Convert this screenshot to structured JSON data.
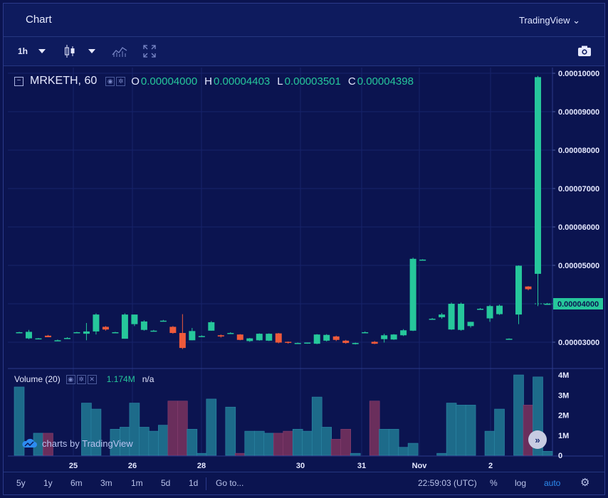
{
  "header": {
    "title": "Chart",
    "provider": "TradingView ⌄"
  },
  "toolbar": {
    "interval": "1h",
    "icons": [
      "candles-icon",
      "dropdown-icon",
      "indicators-icon",
      "fullscreen-icon",
      "camera-icon"
    ]
  },
  "legend": {
    "symbol": "MRKETH, 60",
    "o_label": "O",
    "o": "0.00004000",
    "h_label": "H",
    "h": "0.00004403",
    "l_label": "L",
    "l": "0.00003501",
    "c_label": "C",
    "c": "0.00004398"
  },
  "volume_legend": {
    "title": "Volume (20)",
    "value": "1.174M",
    "na": "n/a"
  },
  "brand": "charts by TradingView",
  "bottombar": {
    "ranges": [
      "5y",
      "1y",
      "6m",
      "3m",
      "1m",
      "5d",
      "1d"
    ],
    "goto": "Go to...",
    "time": "22:59:03 (UTC)",
    "percent": "%",
    "log": "log",
    "auto": "auto"
  },
  "colors": {
    "bg": "#0b1450",
    "up": "#26c79b",
    "down": "#ef5a3b",
    "accent": "#2d8cf0"
  },
  "chart_data": {
    "type": "candlestick",
    "price_axis_labels": [
      "0.00010000",
      "0.00009000",
      "0.00008000",
      "0.00007000",
      "0.00006000",
      "0.00005000",
      "0.00003000"
    ],
    "last_price_label": "0.00004000",
    "volume_axis_labels": [
      "4M",
      "3M",
      "2M",
      "1M",
      "0"
    ],
    "x_tick_labels": [
      "25",
      "26",
      "28",
      "30",
      "31",
      "Nov",
      "2"
    ],
    "ylim": [
      2.7e-05,
      0.000101
    ],
    "volume_ylim": [
      0,
      4000000
    ],
    "candles": [
      {
        "o": 3.25e-05,
        "h": 3.27e-05,
        "l": 3.25e-05,
        "c": 3.26e-05
      },
      {
        "o": 3.1e-05,
        "h": 3.32e-05,
        "l": 3.08e-05,
        "c": 3.27e-05
      },
      {
        "o": 3.09e-05,
        "h": 3.11e-05,
        "l": 3.08e-05,
        "c": 3.1e-05
      },
      {
        "o": 3.17e-05,
        "h": 3.19e-05,
        "l": 3.13e-05,
        "c": 3.13e-05
      },
      {
        "o": 3.05e-05,
        "h": 3.07e-05,
        "l": 3.03e-05,
        "c": 3.05e-05
      },
      {
        "o": 3.11e-05,
        "h": 3.13e-05,
        "l": 3.09e-05,
        "c": 3.11e-05
      },
      {
        "o": 3.25e-05,
        "h": 3.27e-05,
        "l": 3.24e-05,
        "c": 3.26e-05
      },
      {
        "o": 3.22e-05,
        "h": 3.5e-05,
        "l": 3.05e-05,
        "c": 3.28e-05
      },
      {
        "o": 3.28e-05,
        "h": 3.75e-05,
        "l": 3.2e-05,
        "c": 3.72e-05
      },
      {
        "o": 3.4e-05,
        "h": 3.42e-05,
        "l": 3.3e-05,
        "c": 3.33e-05
      },
      {
        "o": 3.25e-05,
        "h": 3.27e-05,
        "l": 3.24e-05,
        "c": 3.26e-05
      },
      {
        "o": 3.09e-05,
        "h": 3.75e-05,
        "l": 3.09e-05,
        "c": 3.72e-05
      },
      {
        "o": 3.47e-05,
        "h": 3.72e-05,
        "l": 3.42e-05,
        "c": 3.72e-05
      },
      {
        "o": 3.32e-05,
        "h": 3.57e-05,
        "l": 3.3e-05,
        "c": 3.54e-05
      },
      {
        "o": 3.3e-05,
        "h": 3.32e-05,
        "l": 3.29e-05,
        "c": 3.3e-05
      },
      {
        "o": 3.56e-05,
        "h": 3.58e-05,
        "l": 3.54e-05,
        "c": 3.56e-05
      },
      {
        "o": 3.4e-05,
        "h": 3.42e-05,
        "l": 3.22e-05,
        "c": 3.24e-05
      },
      {
        "o": 3.24e-05,
        "h": 3.73e-05,
        "l": 2.82e-05,
        "c": 2.85e-05
      },
      {
        "o": 3.05e-05,
        "h": 3.37e-05,
        "l": 3.05e-05,
        "c": 3.29e-05
      },
      {
        "o": 3.16e-05,
        "h": 3.18e-05,
        "l": 3.14e-05,
        "c": 3.16e-05
      },
      {
        "o": 3.3e-05,
        "h": 3.55e-05,
        "l": 3.3e-05,
        "c": 3.52e-05
      },
      {
        "o": 3.18e-05,
        "h": 3.2e-05,
        "l": 3.12e-05,
        "c": 3.15e-05
      },
      {
        "o": 3.24e-05,
        "h": 3.26e-05,
        "l": 3.22e-05,
        "c": 3.24e-05
      },
      {
        "o": 3.2e-05,
        "h": 3.21e-05,
        "l": 3.05e-05,
        "c": 3.06e-05
      },
      {
        "o": 3.03e-05,
        "h": 3.11e-05,
        "l": 3.01e-05,
        "c": 3.1e-05
      },
      {
        "o": 3.05e-05,
        "h": 3.23e-05,
        "l": 3.04e-05,
        "c": 3.22e-05
      },
      {
        "o": 3.04e-05,
        "h": 3.23e-05,
        "l": 3.03e-05,
        "c": 3.22e-05
      },
      {
        "o": 3.23e-05,
        "h": 3.24e-05,
        "l": 2.97e-05,
        "c": 2.99e-05
      },
      {
        "o": 3.01e-05,
        "h": 3.02e-05,
        "l": 2.96e-05,
        "c": 2.99e-05
      },
      {
        "o": 2.98e-05,
        "h": 2.99e-05,
        "l": 2.97e-05,
        "c": 2.98e-05
      },
      {
        "o": 2.98e-05,
        "h": 2.99e-05,
        "l": 2.96e-05,
        "c": 2.99e-05
      },
      {
        "o": 2.96e-05,
        "h": 3.21e-05,
        "l": 2.95e-05,
        "c": 3.2e-05
      },
      {
        "o": 3.04e-05,
        "h": 3.21e-05,
        "l": 3.02e-05,
        "c": 3.19e-05
      },
      {
        "o": 3.15e-05,
        "h": 3.17e-05,
        "l": 3.03e-05,
        "c": 3.06e-05
      },
      {
        "o": 3.04e-05,
        "h": 3.06e-05,
        "l": 2.96e-05,
        "c": 2.98e-05
      },
      {
        "o": 2.95e-05,
        "h": 2.99e-05,
        "l": 2.94e-05,
        "c": 2.98e-05
      },
      {
        "o": 3.26e-05,
        "h": 3.28e-05,
        "l": 3.25e-05,
        "c": 3.26e-05
      },
      {
        "o": 3.01e-05,
        "h": 3.03e-05,
        "l": 2.95e-05,
        "c": 2.96e-05
      },
      {
        "o": 3.08e-05,
        "h": 3.22e-05,
        "l": 2.99e-05,
        "c": 3.18e-05
      },
      {
        "o": 3.07e-05,
        "h": 3.21e-05,
        "l": 3.06e-05,
        "c": 3.2e-05
      },
      {
        "o": 3.18e-05,
        "h": 3.34e-05,
        "l": 3.16e-05,
        "c": 3.31e-05
      },
      {
        "o": 3.3e-05,
        "h": 5.2e-05,
        "l": 3.29e-05,
        "c": 5.17e-05
      },
      {
        "o": 5.15e-05,
        "h": 5.16e-05,
        "l": 5.14e-05,
        "c": 5.15e-05
      },
      {
        "o": 3.61e-05,
        "h": 3.63e-05,
        "l": 3.6e-05,
        "c": 3.61e-05
      },
      {
        "o": 3.65e-05,
        "h": 3.76e-05,
        "l": 3.61e-05,
        "c": 3.72e-05
      },
      {
        "o": 3.33e-05,
        "h": 4.03e-05,
        "l": 3.32e-05,
        "c": 4e-05
      },
      {
        "o": 3.32e-05,
        "h": 4.03e-05,
        "l": 3.3e-05,
        "c": 4e-05
      },
      {
        "o": 3.42e-05,
        "h": 3.53e-05,
        "l": 3.38e-05,
        "c": 3.53e-05
      },
      {
        "o": 3.87e-05,
        "h": 3.89e-05,
        "l": 3.85e-05,
        "c": 3.87e-05
      },
      {
        "o": 3.62e-05,
        "h": 3.97e-05,
        "l": 3.53e-05,
        "c": 3.94e-05
      },
      {
        "o": 3.73e-05,
        "h": 3.98e-05,
        "l": 3.71e-05,
        "c": 3.95e-05
      },
      {
        "o": 3.08e-05,
        "h": 3.1e-05,
        "l": 3.07e-05,
        "c": 3.09e-05
      },
      {
        "o": 3.72e-05,
        "h": 5e-05,
        "l": 3.47e-05,
        "c": 4.99e-05
      },
      {
        "o": 4.45e-05,
        "h": 4.46e-05,
        "l": 4.35e-05,
        "c": 4.38e-05
      },
      {
        "o": 4.78e-05,
        "h": 9.93e-05,
        "l": 3.94e-05,
        "c": 9.9e-05
      },
      {
        "o": 4e-05,
        "h": 4.02e-05,
        "l": 3.98e-05,
        "c": 4e-05
      }
    ],
    "volumes": [
      3.4,
      0,
      1.1,
      1.1,
      0,
      0,
      0,
      2.6,
      2.3,
      0,
      1.3,
      1.4,
      2.6,
      1.4,
      1.2,
      1.5,
      2.7,
      2.7,
      1.3,
      0.1,
      2.8,
      0,
      2.4,
      0.1,
      1.2,
      1.2,
      1.1,
      1.1,
      1.2,
      1.3,
      1.2,
      2.9,
      1.4,
      0.8,
      1.3,
      0.1,
      0,
      2.7,
      1.3,
      1.3,
      0.4,
      0.6,
      0,
      0,
      0.1,
      2.6,
      2.5,
      2.5,
      0,
      1.2,
      2.3,
      0,
      4.0,
      2.5,
      3.9,
      0.2
    ]
  }
}
